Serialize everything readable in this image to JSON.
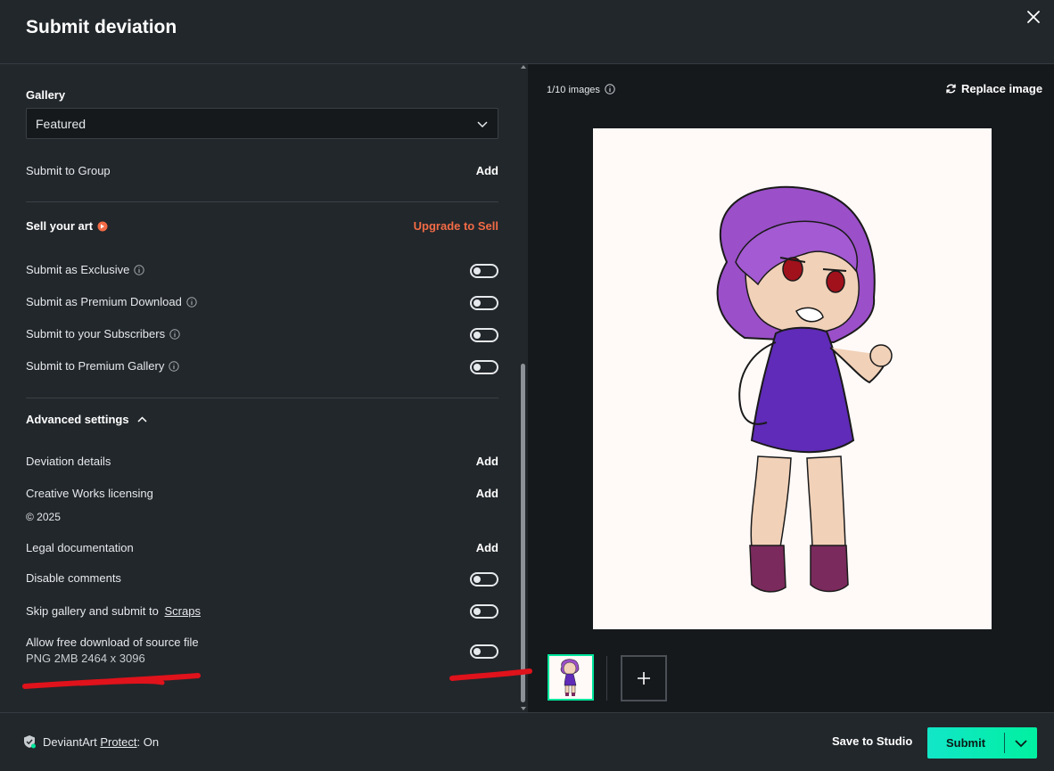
{
  "header": {
    "title": "Submit deviation"
  },
  "left": {
    "gallery_label": "Gallery",
    "gallery_value": "Featured",
    "submit_group_label": "Submit to Group",
    "add_label": "Add",
    "sell_label": "Sell your art",
    "upgrade_label": "Upgrade to Sell",
    "toggles": [
      {
        "label": "Submit as Exclusive",
        "on": false
      },
      {
        "label": "Submit as Premium Download",
        "on": false
      },
      {
        "label": "Submit to your Subscribers",
        "on": false
      },
      {
        "label": "Submit to Premium Gallery",
        "on": false
      }
    ],
    "advanced_label": "Advanced settings",
    "deviation_details_label": "Deviation details",
    "creative_works_label": "Creative Works licensing",
    "copyright": "© 2025",
    "legal_label": "Legal documentation",
    "disable_comments_label": "Disable comments",
    "skip_gallery_prefix": "Skip gallery and submit to",
    "skip_gallery_link": "Scraps",
    "free_download_label": "Allow free download of source file",
    "file_info": "PNG 2MB 2464 x 3096"
  },
  "right": {
    "image_count": "1/10 images",
    "replace_label": "Replace image"
  },
  "footer": {
    "brand": "DeviantArt",
    "protect_link": "Protect",
    "protect_status": ": On",
    "save_label": "Save to Studio",
    "submit_label": "Submit"
  },
  "colors": {
    "accent": "#00e59b",
    "upgrade": "#f26b46",
    "annotation": "#e0121b"
  }
}
